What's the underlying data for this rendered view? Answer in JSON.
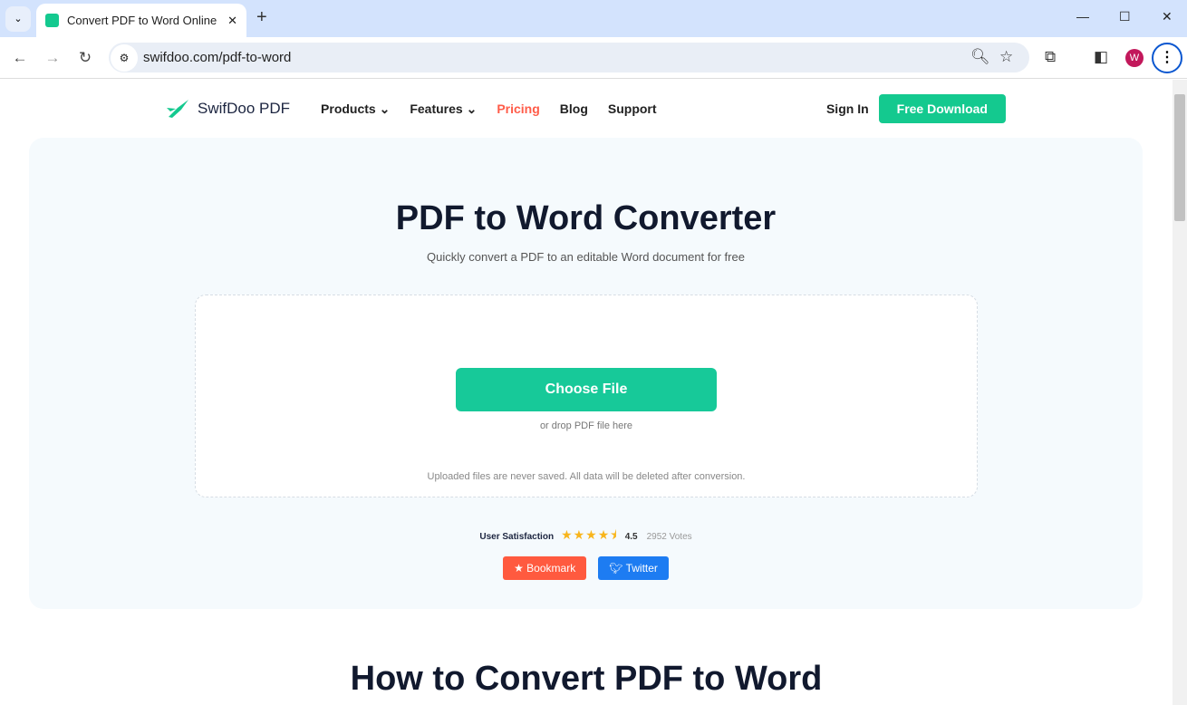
{
  "browser": {
    "tab_title": "Convert PDF to Word Online",
    "url": "swifdoo.com/pdf-to-word",
    "profile_initial": "W"
  },
  "nav": {
    "logo": "SwifDoo PDF",
    "items": [
      {
        "label": "Products ⌄"
      },
      {
        "label": "Features ⌄"
      },
      {
        "label": "Pricing",
        "color": "#ff5c49"
      },
      {
        "label": "Blog"
      },
      {
        "label": "Support"
      }
    ],
    "sign_in": "Sign In",
    "download": "Free Download"
  },
  "hero": {
    "title": "PDF to Word Converter",
    "subtitle": "Quickly convert a PDF to an editable Word document for free",
    "choose": "Choose File",
    "drop_hint": "or drop PDF file here",
    "note": "Uploaded files are never saved. All data will be deleted after conversion.",
    "rating": {
      "label": "User Satisfaction",
      "score": "4.5",
      "votes": "2952 Votes",
      "stars": 4.5
    },
    "bookmark": "Bookmark",
    "twitter": "Twitter"
  },
  "section": {
    "title": "How to Convert PDF to Word"
  },
  "colors": {
    "brand": "#14c98f",
    "bookmark": "#ff5a3f",
    "twitter": "#1d7cf2"
  }
}
